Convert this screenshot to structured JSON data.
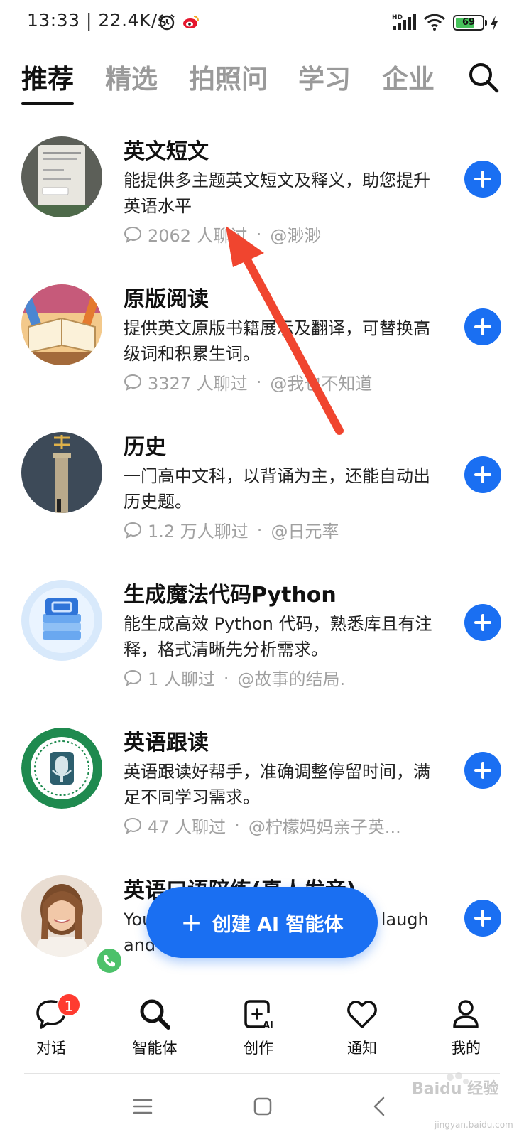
{
  "status_bar": {
    "time_speed": "13:33 | 22.4K/s",
    "battery": "69"
  },
  "tabs": [
    {
      "label": "推荐",
      "active": true
    },
    {
      "label": "精选",
      "active": false
    },
    {
      "label": "拍照问",
      "active": false
    },
    {
      "label": "学习",
      "active": false
    },
    {
      "label": "企业",
      "active": false
    }
  ],
  "bots": [
    {
      "title": "英文短文",
      "description": "能提供多主题英文短文及释义，助您提升英语水平",
      "chats": "2062 人聊过",
      "author": "@渺渺"
    },
    {
      "title": "原版阅读",
      "description": "提供英文原版书籍展示及翻译，可替换高级词和积累生词。",
      "chats": "3327 人聊过",
      "author": "@我也不知道"
    },
    {
      "title": "历史",
      "description": "一门高中文科，以背诵为主，还能自动出历史题。",
      "chats": "1.2 万人聊过",
      "author": "@日元率"
    },
    {
      "title": "生成魔法代码Python",
      "description": "能生成高效 Python 代码，熟悉库且有注释，格式清晰先分析需求。",
      "chats": "1 人聊过",
      "author": "@故事的结局."
    },
    {
      "title": "英语跟读",
      "description": "英语跟读好帮手，准确调整停留时间，满足不同学习需求。",
      "chats": "47 人聊过",
      "author": "@柠檬妈妈亲子英..."
    },
    {
      "title": "英语口语陪练(真人发音)",
      "description": "You culture pro ready to chat, laugh and boos...",
      "chats": "",
      "author": ""
    }
  ],
  "meta_separator": "·",
  "fab": {
    "label": "创建 AI 智能体"
  },
  "bottom_nav": [
    {
      "label": "对话",
      "badge": "1"
    },
    {
      "label": "智能体"
    },
    {
      "label": "创作"
    },
    {
      "label": "通知"
    },
    {
      "label": "我的"
    }
  ],
  "watermark": {
    "text": "Baidu 经验",
    "sub": "jingyan.baidu.com"
  },
  "colors": {
    "accent": "#1a6ff2",
    "badge": "#ff3b30",
    "annotation": "#f0452f"
  }
}
